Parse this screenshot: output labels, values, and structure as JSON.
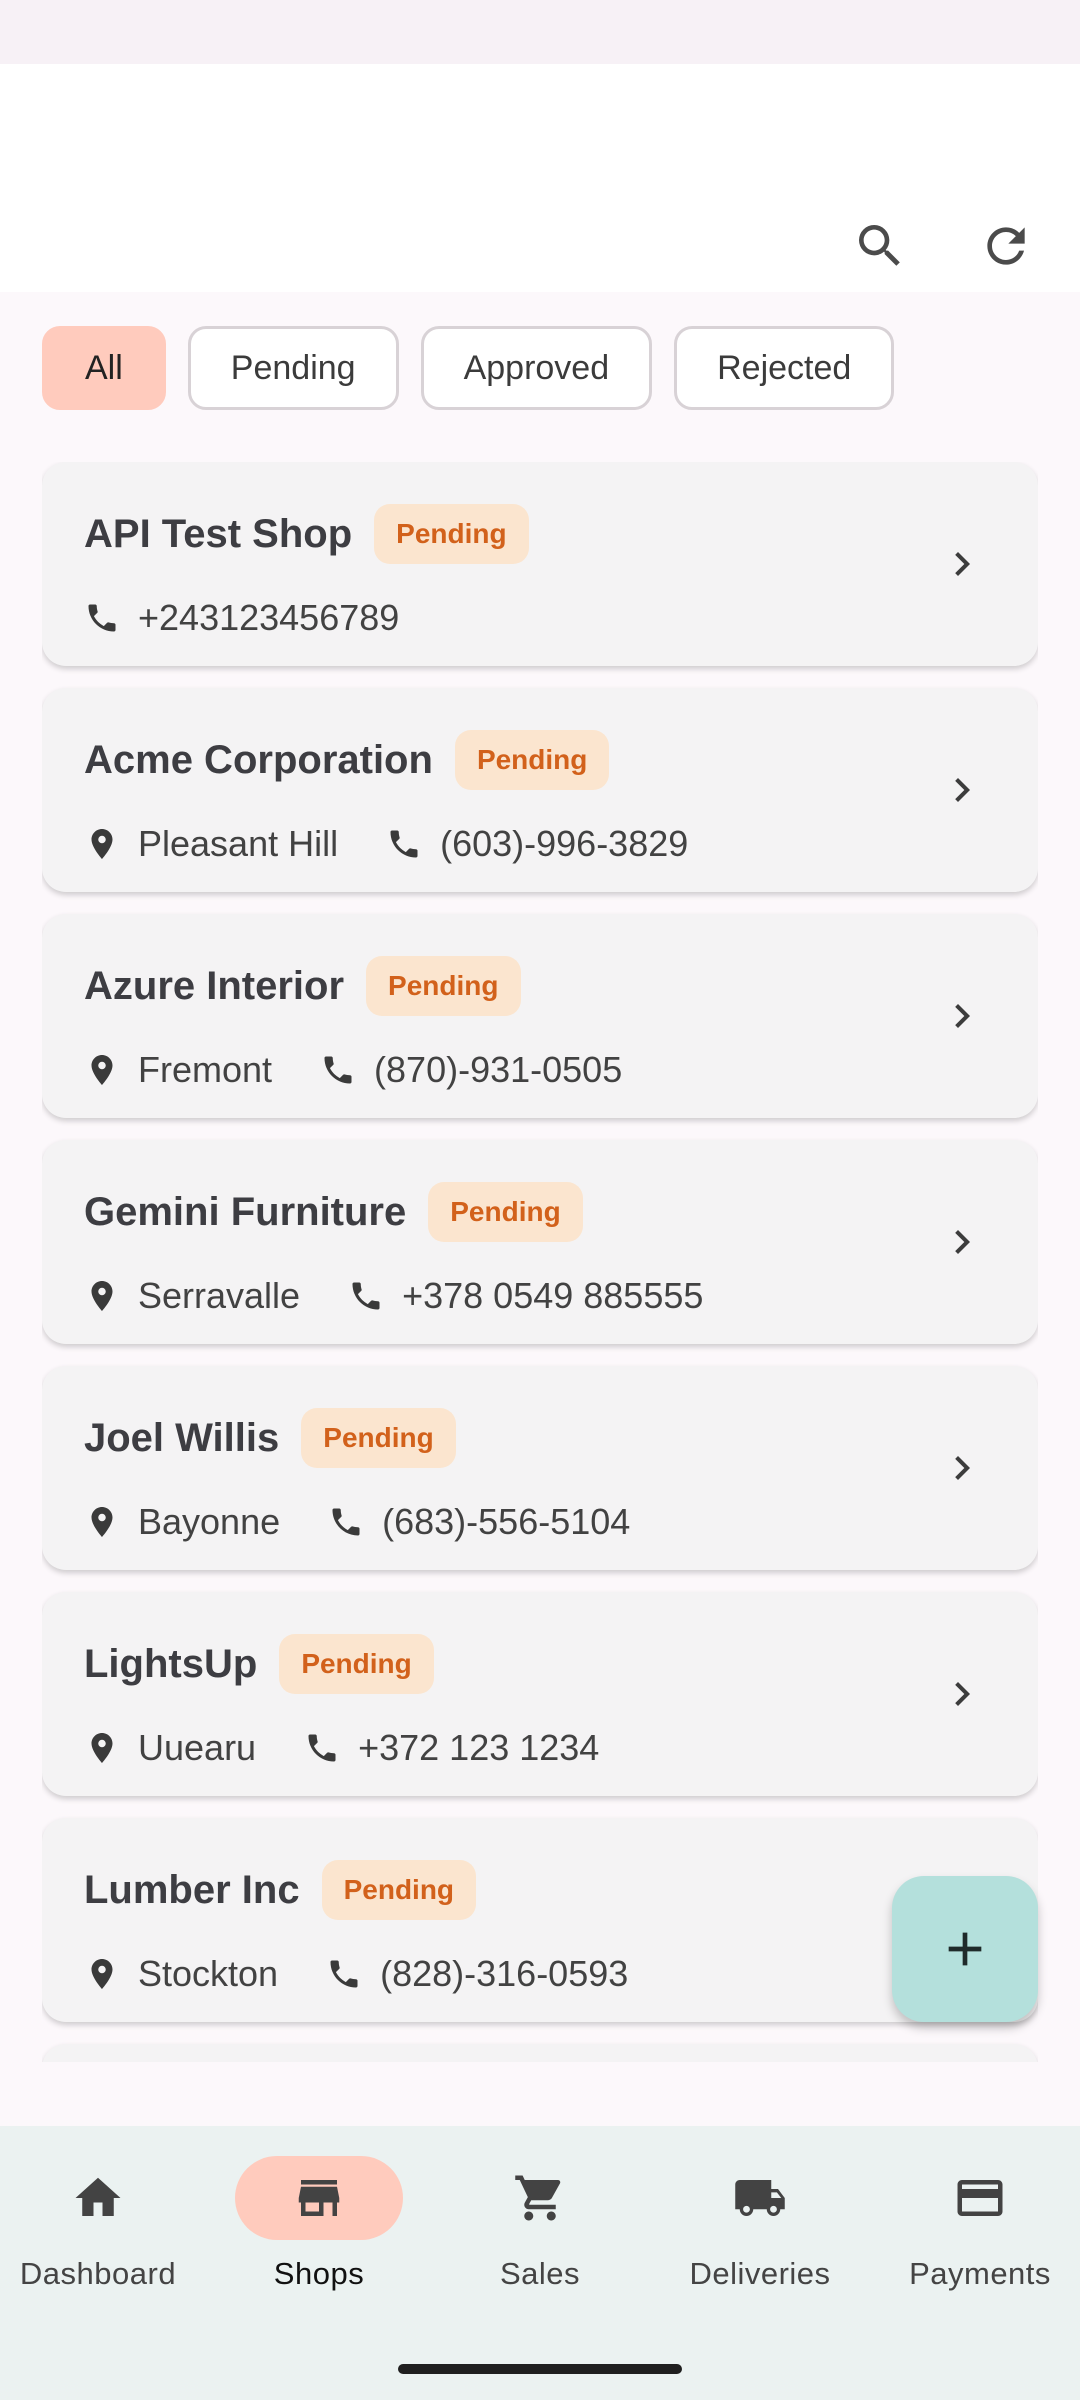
{
  "filters": {
    "all": "All",
    "pending": "Pending",
    "approved": "Approved",
    "rejected": "Rejected"
  },
  "shops": [
    {
      "name": "API Test Shop",
      "status": "Pending",
      "location": "",
      "phone": "+243123456789"
    },
    {
      "name": "Acme Corporation",
      "status": "Pending",
      "location": "Pleasant Hill",
      "phone": "(603)-996-3829"
    },
    {
      "name": "Azure Interior",
      "status": "Pending",
      "location": "Fremont",
      "phone": "(870)-931-0505"
    },
    {
      "name": "Gemini Furniture",
      "status": "Pending",
      "location": "Serravalle",
      "phone": "+378 0549 885555"
    },
    {
      "name": "Joel Willis",
      "status": "Pending",
      "location": "Bayonne",
      "phone": "(683)-556-5104"
    },
    {
      "name": "LightsUp",
      "status": "Pending",
      "location": "Uuearu",
      "phone": "+372 123 1234"
    },
    {
      "name": "Lumber Inc",
      "status": "Pending",
      "location": "Stockton",
      "phone": "(828)-316-0593"
    }
  ],
  "nav": {
    "dashboard": "Dashboard",
    "shops": "Shops",
    "sales": "Sales",
    "deliveries": "Deliveries",
    "payments": "Payments"
  },
  "colors": {
    "accent_selected": "#ffcbbd",
    "badge_bg": "#fbe5cf",
    "badge_text": "#d2611b",
    "fab": "#b4e0dc"
  }
}
